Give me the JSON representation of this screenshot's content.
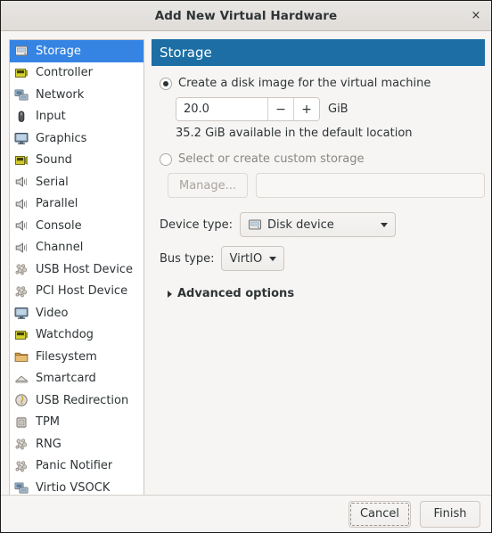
{
  "window": {
    "title": "Add New Virtual Hardware",
    "close_label": "×"
  },
  "sidebar": {
    "selected_index": 0,
    "items": [
      {
        "label": "Storage",
        "icon": "disk-icon"
      },
      {
        "label": "Controller",
        "icon": "controller-icon"
      },
      {
        "label": "Network",
        "icon": "network-icon"
      },
      {
        "label": "Input",
        "icon": "mouse-icon"
      },
      {
        "label": "Graphics",
        "icon": "monitor-icon"
      },
      {
        "label": "Sound",
        "icon": "sound-icon"
      },
      {
        "label": "Serial",
        "icon": "serial-icon"
      },
      {
        "label": "Parallel",
        "icon": "parallel-icon"
      },
      {
        "label": "Console",
        "icon": "console-icon"
      },
      {
        "label": "Channel",
        "icon": "channel-icon"
      },
      {
        "label": "USB Host Device",
        "icon": "usb-host-icon"
      },
      {
        "label": "PCI Host Device",
        "icon": "pci-host-icon"
      },
      {
        "label": "Video",
        "icon": "video-icon"
      },
      {
        "label": "Watchdog",
        "icon": "watchdog-icon"
      },
      {
        "label": "Filesystem",
        "icon": "folder-icon"
      },
      {
        "label": "Smartcard",
        "icon": "smartcard-icon"
      },
      {
        "label": "USB Redirection",
        "icon": "usb-redirection-icon"
      },
      {
        "label": "TPM",
        "icon": "chip-icon"
      },
      {
        "label": "RNG",
        "icon": "rng-icon"
      },
      {
        "label": "Panic Notifier",
        "icon": "panic-icon"
      },
      {
        "label": "Virtio VSOCK",
        "icon": "vsock-icon"
      }
    ]
  },
  "panel": {
    "header": "Storage",
    "create_radio": {
      "label": "Create a disk image for the virtual machine",
      "checked": true
    },
    "size": {
      "value": "20.0",
      "minus_label": "−",
      "plus_label": "+",
      "unit": "GiB"
    },
    "available_text": "35.2 GiB available in the default location",
    "custom_radio": {
      "label": "Select or create custom storage",
      "checked": false
    },
    "manage_button": {
      "label": "Manage...",
      "enabled": false
    },
    "path_field": {
      "value": "",
      "placeholder": "",
      "enabled": false
    },
    "device_type": {
      "label": "Device type:",
      "value": "Disk device",
      "icon": "disk-icon"
    },
    "bus_type": {
      "label": "Bus type:",
      "value": "VirtIO"
    },
    "advanced": {
      "label": "Advanced options",
      "expanded": false
    }
  },
  "footer": {
    "cancel_label": "Cancel",
    "finish_label": "Finish"
  },
  "colors": {
    "selection_blue": "#3584e4",
    "header_blue": "#1c6ea4",
    "window_bg": "#f6f5f4",
    "list_bg": "#ffffff",
    "text": "#2e3436",
    "disabled_text": "#a9a49e"
  }
}
